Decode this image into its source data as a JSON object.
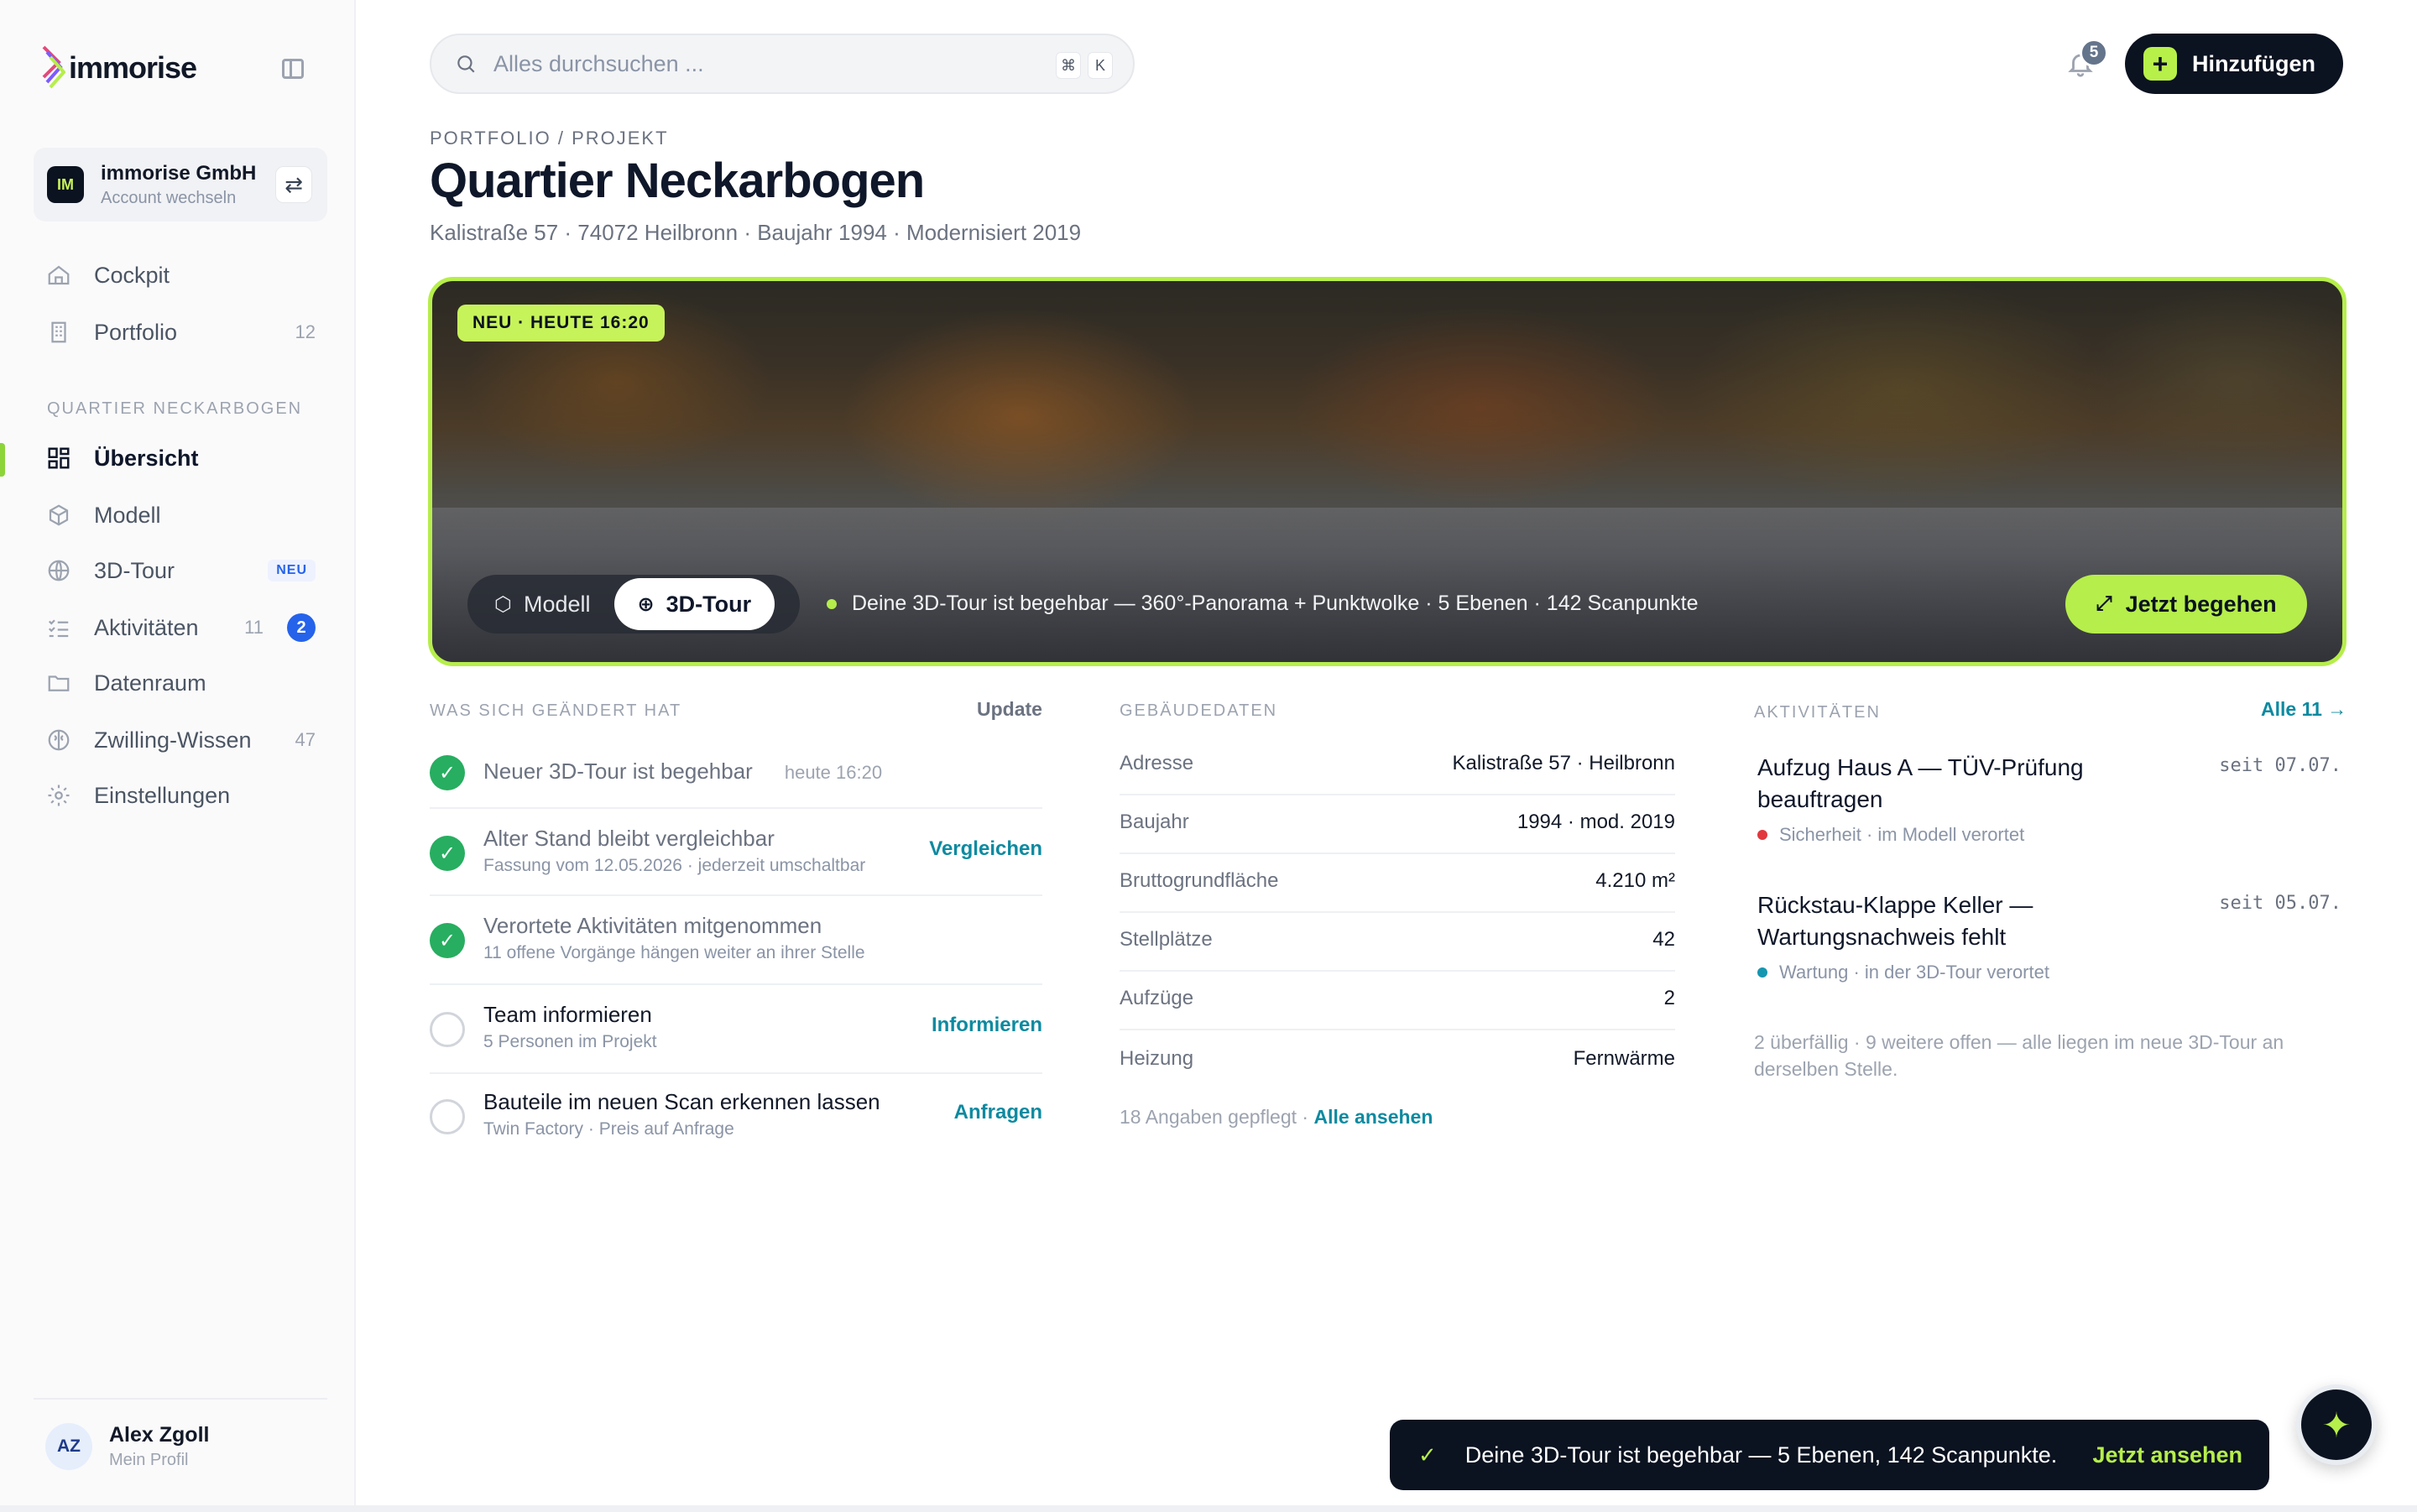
{
  "brand": {
    "name": "immorise"
  },
  "account": {
    "initials": "IM",
    "name": "immorise GmbH",
    "switch_label": "Account wechseln"
  },
  "nav": {
    "top": [
      {
        "label": "Cockpit",
        "count": ""
      },
      {
        "label": "Portfolio",
        "count": "12"
      }
    ],
    "section_title": "QUARTIER NECKARBOGEN",
    "project": [
      {
        "label": "Übersicht"
      },
      {
        "label": "Modell"
      },
      {
        "label": "3D-Tour",
        "badge": "NEU"
      },
      {
        "label": "Aktivitäten",
        "count": "11",
        "badge_count": "2"
      },
      {
        "label": "Datenraum"
      },
      {
        "label": "Zwilling-Wissen",
        "count": "47"
      },
      {
        "label": "Einstellungen"
      }
    ]
  },
  "profile": {
    "initials": "AZ",
    "name": "Alex Zgoll",
    "sub": "Mein Profil"
  },
  "search": {
    "placeholder": "Alles durchsuchen ...",
    "kbd1": "⌘",
    "kbd2": "K"
  },
  "header": {
    "notification_count": "5",
    "add_label": "Hinzufügen"
  },
  "page": {
    "breadcrumb": "PORTFOLIO / PROJEKT",
    "title": "Quartier Neckarbogen",
    "subtitle": "Kalistraße 57 · 74072 Heilbronn · Baujahr 1994 · Modernisiert 2019"
  },
  "hero": {
    "badge": "NEU · HEUTE 16:20",
    "toggle_model": "Modell",
    "toggle_tour": "3D-Tour",
    "status": "Deine 3D-Tour ist begehbar — 360°-Panorama + Punktwolke · 5 Ebenen · 142 Scanpunkte",
    "cta": "Jetzt begehen"
  },
  "changes": {
    "label": "WAS SICH GEÄNDERT HAT",
    "link": "Update",
    "items": [
      {
        "title": "Neuer 3D-Tour ist begehbar",
        "time": "heute 16:20",
        "sub": "",
        "action": "",
        "done": true
      },
      {
        "title": "Alter Stand bleibt vergleichbar",
        "sub": "Fassung vom 12.05.2026 · jederzeit umschaltbar",
        "action": "Vergleichen",
        "done": true
      },
      {
        "title": "Verortete Aktivitäten mitgenommen",
        "sub": "11 offene Vorgänge hängen weiter an ihrer Stelle",
        "action": "",
        "done": true
      },
      {
        "title": "Team informieren",
        "sub": "5 Personen im Projekt",
        "action": "Informieren",
        "done": false
      },
      {
        "title": "Bauteile im neuen Scan erkennen lassen",
        "sub": "Twin Factory · Preis auf Anfrage",
        "action": "Anfragen",
        "done": false
      }
    ]
  },
  "building": {
    "label": "GEBÄUDEDATEN",
    "rows": [
      {
        "k": "Adresse",
        "v": "Kalistraße 57 · Heilbronn"
      },
      {
        "k": "Baujahr",
        "v": "1994 · mod. 2019"
      },
      {
        "k": "Bruttogrundfläche",
        "v": "4.210 m²"
      },
      {
        "k": "Stellplätze",
        "v": "42"
      },
      {
        "k": "Aufzüge",
        "v": "2"
      },
      {
        "k": "Heizung",
        "v": "Fernwärme"
      }
    ],
    "footer_text": "18 Angaben gepflegt · ",
    "footer_link": "Alle ansehen"
  },
  "activities": {
    "label": "AKTIVITÄTEN",
    "link": "Alle 11 →",
    "items": [
      {
        "title": "Aufzug Haus A — TÜV-Prüfung beauftragen",
        "date": "seit 07.07.",
        "meta": "Sicherheit · im Modell verortet",
        "color": "#e0383e"
      },
      {
        "title": "Rückstau-Klappe Keller — Wartungsnachweis fehlt",
        "date": "seit 05.07.",
        "meta": "Wartung · in der 3D-Tour verortet",
        "color": "#1596b0"
      }
    ],
    "note": "2 überfällig · 9 weitere offen — alle liegen im neue 3D-Tour an derselben Stelle."
  },
  "toast": {
    "text": "Deine 3D-Tour ist begehbar — 5 Ebenen, 142 Scanpunkte.",
    "action": "Jetzt ansehen"
  },
  "colors": {
    "accent": "#b6ee4b",
    "dark": "#0b1220",
    "link": "#0d8aa0",
    "success": "#27ae60",
    "badge_blue": "#2563eb"
  }
}
